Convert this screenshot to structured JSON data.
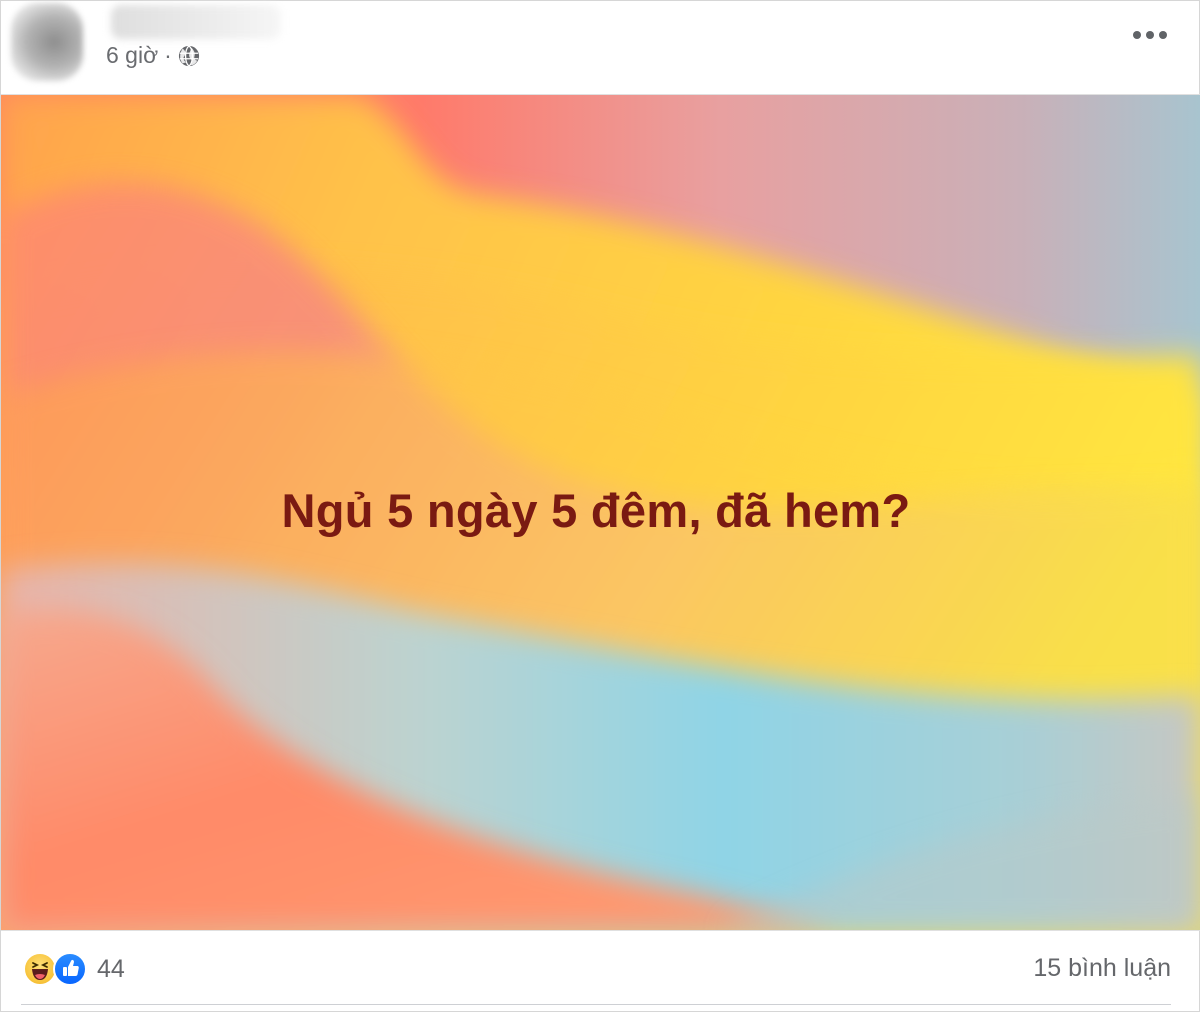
{
  "post": {
    "time": "6 giờ",
    "separator": "·",
    "privacy_icon": "globe-icon",
    "more_icon": "more-horizontal-icon"
  },
  "image": {
    "caption": "Ngủ 5 ngày 5 đêm, đã hem?",
    "caption_color": "#7a1a12",
    "background_colors": [
      "#ff8c5a",
      "#ffd24a",
      "#f29a86",
      "#8fd3e3"
    ]
  },
  "footer": {
    "reaction_icons": [
      "haha-icon",
      "like-icon"
    ],
    "reaction_count": "44",
    "comments": "15 bình luận"
  }
}
